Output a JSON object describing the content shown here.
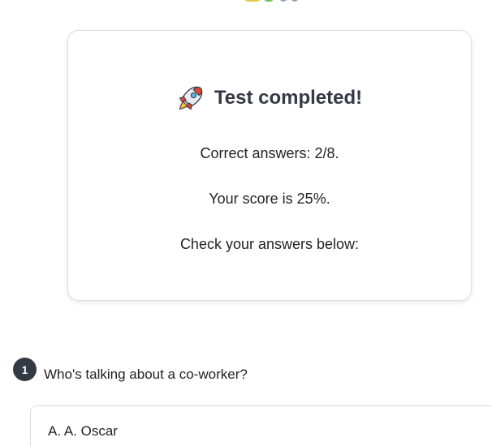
{
  "colors": {
    "title_text": "#343a44",
    "card_border": "#dedede",
    "number_badge_bg": "#343a44",
    "top_fragment_colors": [
      "#e8c94a",
      "#6fbf5a",
      "#9aa3ad"
    ]
  },
  "result": {
    "icon": "rocket-icon",
    "title": "Test completed!",
    "correct_answers": "Correct answers: 2/8.",
    "score": "Your score is 25%.",
    "check_answers": "Check your answers below:"
  },
  "questions": [
    {
      "number": "1",
      "text": "Who's talking about a co-worker?",
      "options": [
        {
          "label": "A. A. Oscar"
        }
      ]
    }
  ]
}
